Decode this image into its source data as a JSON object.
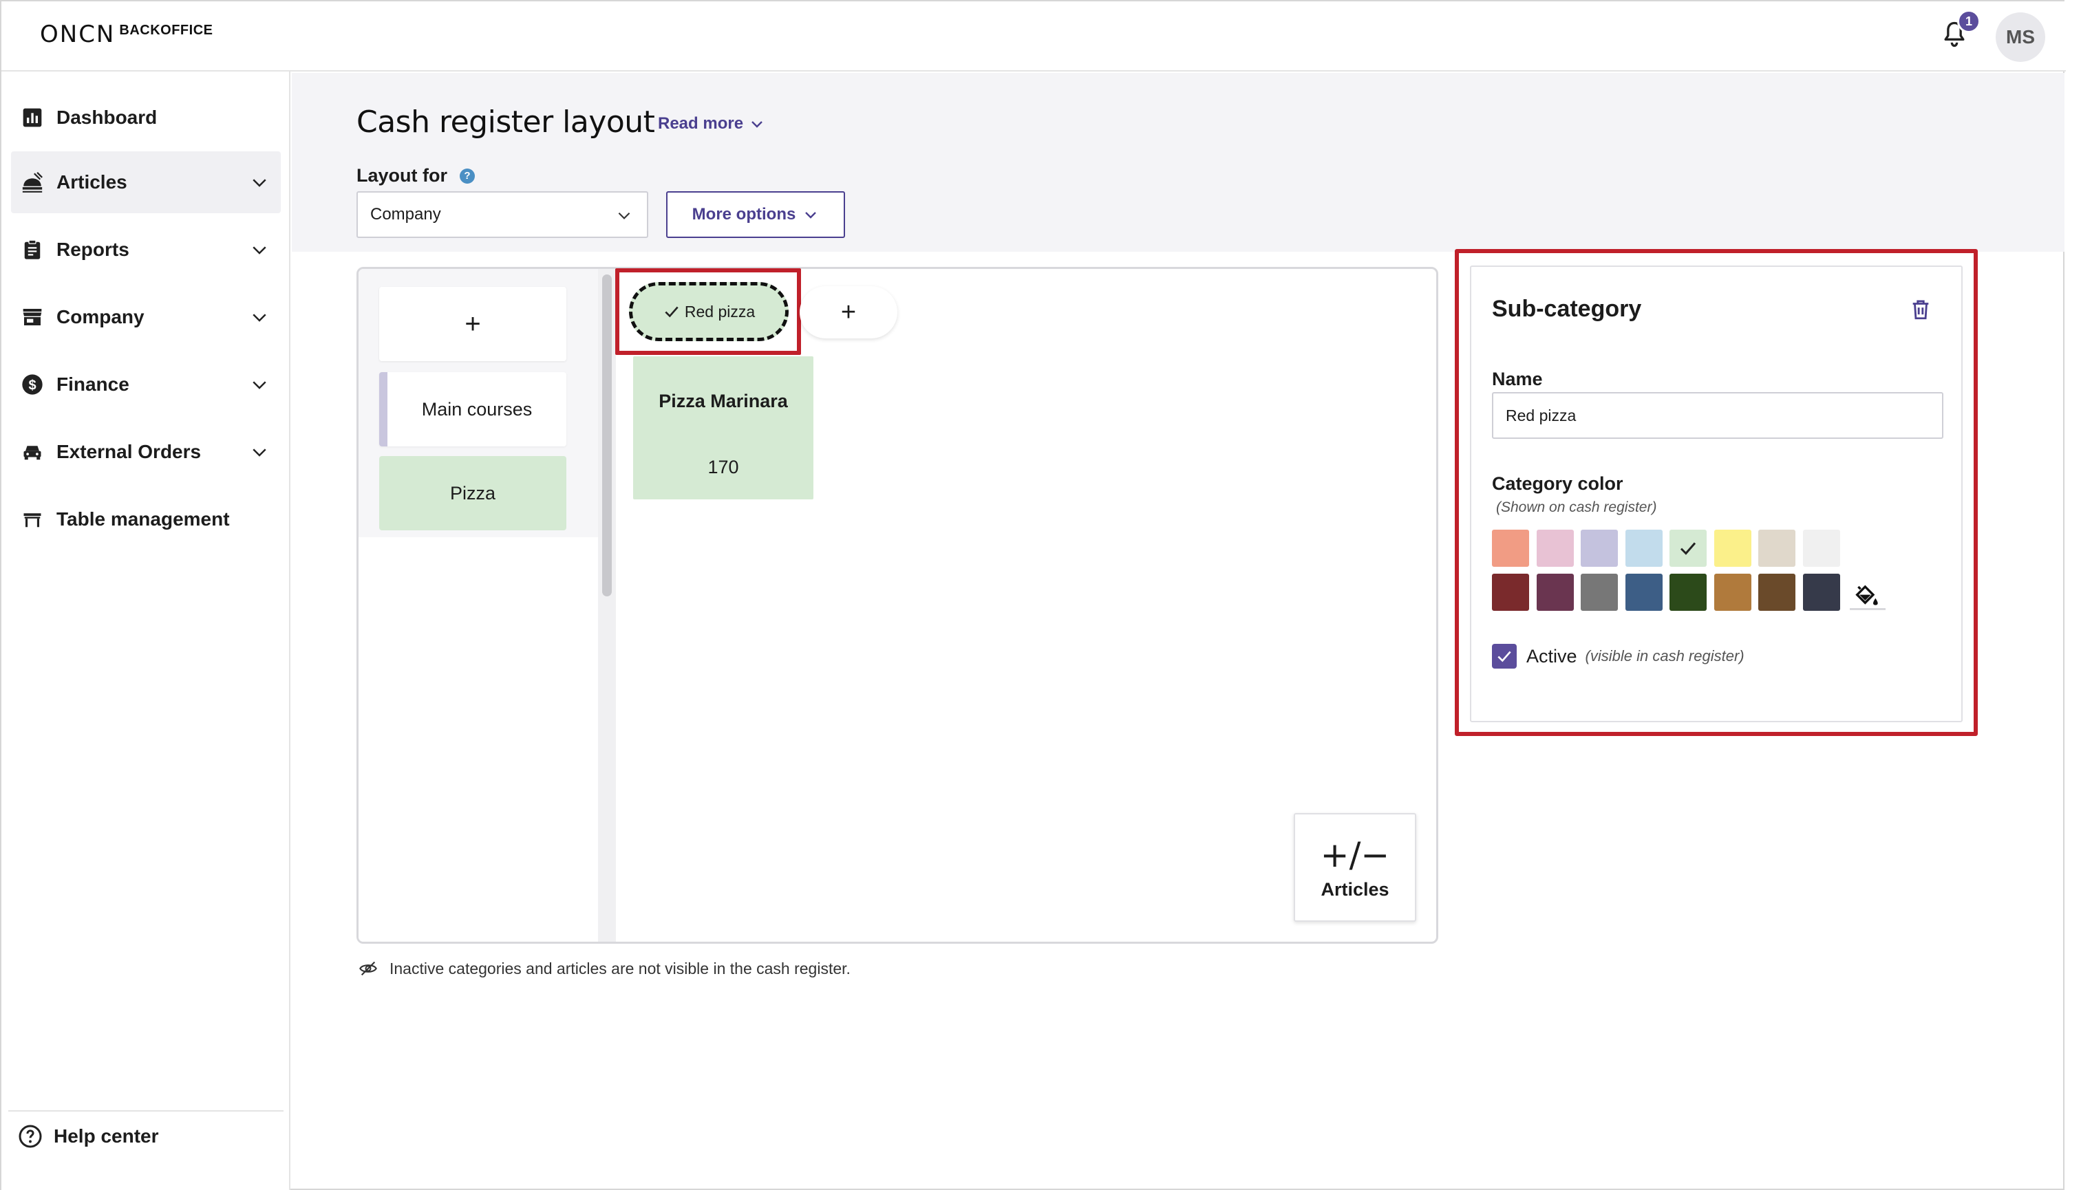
{
  "app": {
    "logo_mark": "ONCN",
    "logo_text": "BACKOFFICE",
    "notification_count": "1",
    "avatar_initials": "MS"
  },
  "sidebar": {
    "items": [
      {
        "label": "Dashboard",
        "icon": "bar-chart-icon",
        "expandable": false
      },
      {
        "label": "Articles",
        "icon": "food-tray-icon",
        "expandable": true,
        "active": true
      },
      {
        "label": "Reports",
        "icon": "clipboard-icon",
        "expandable": true
      },
      {
        "label": "Company",
        "icon": "storefront-icon",
        "expandable": true
      },
      {
        "label": "Finance",
        "icon": "dollar-circle-icon",
        "expandable": true
      },
      {
        "label": "External Orders",
        "icon": "car-icon",
        "expandable": true
      },
      {
        "label": "Table management",
        "icon": "table-icon",
        "expandable": false
      }
    ],
    "help_label": "Help center"
  },
  "header": {
    "title": "Cash register layout",
    "read_more": "Read more",
    "layout_for_label": "Layout for",
    "layout_for_value": "Company",
    "more_options": "More options"
  },
  "canvas": {
    "categories": [
      {
        "label": "+"
      },
      {
        "label": "Main courses"
      },
      {
        "label": "Pizza"
      }
    ],
    "selected_subcategory": "Red pizza",
    "add_subcategory": "+",
    "articles": [
      {
        "name": "Pizza Marinara",
        "price": "170"
      }
    ],
    "articles_button_symbol": "+/−",
    "articles_button_label": "Articles",
    "inactive_note": "Inactive categories and articles are not visible in the cash register."
  },
  "panel": {
    "title": "Sub-category",
    "name_label": "Name",
    "name_value": "Red pizza",
    "color_label": "Category color",
    "color_hint": "(Shown on cash register)",
    "colors_row1": [
      "#f19c84",
      "#e8c2d4",
      "#c4c2de",
      "#c2dcec",
      "#d5ead3",
      "#fbf08a",
      "#e0d8cb",
      "#f0f0f0"
    ],
    "colors_row2": [
      "#7a2a2c",
      "#6a3550",
      "#777777",
      "#3d5e86",
      "#2c4a1a",
      "#b07a3c",
      "#6a4a2a",
      "#363a4a"
    ],
    "selected_color": "#d5ead3",
    "active_label": "Active",
    "active_hint": "(visible in cash register)",
    "active_checked": true
  },
  "colors": {
    "accent": "#4a3f8f",
    "highlight": "#c0202a"
  }
}
